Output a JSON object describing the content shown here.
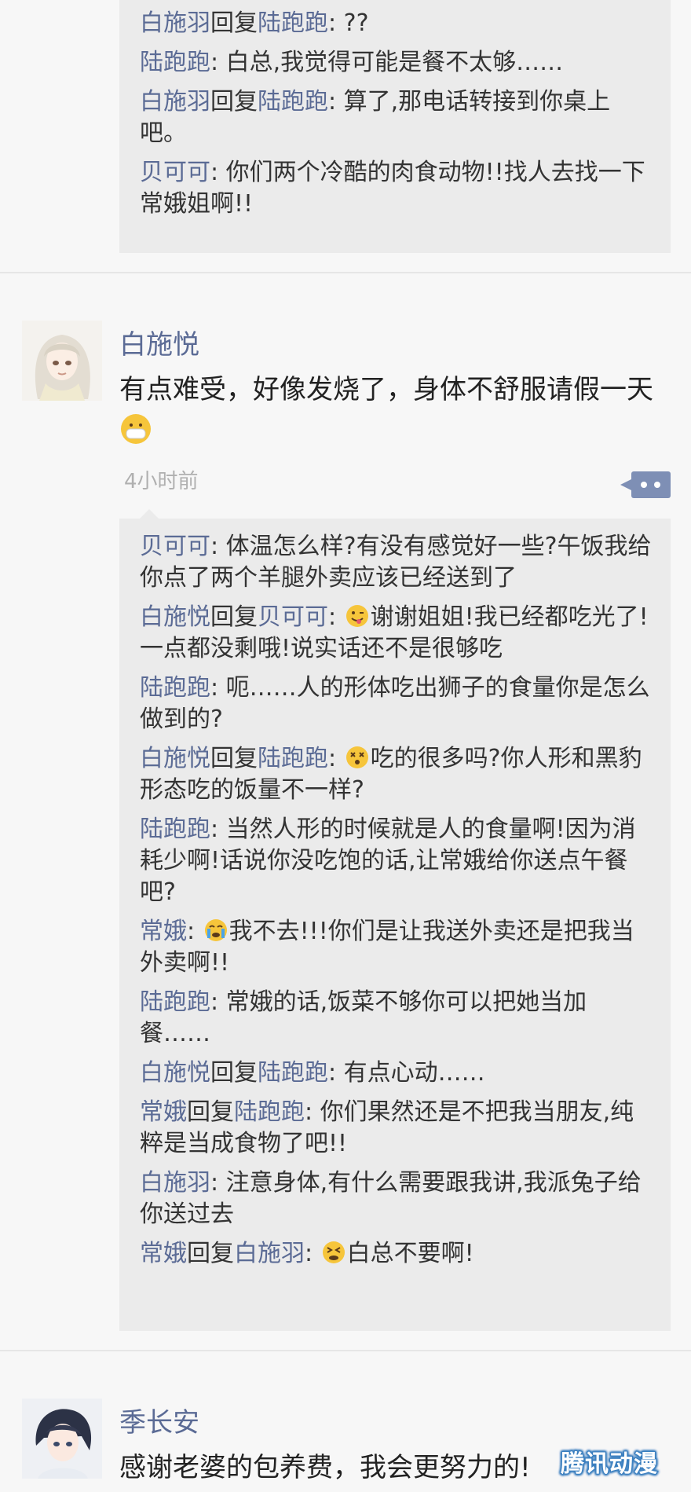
{
  "top_replies": [
    {
      "parts": [
        {
          "n": "白施羽"
        },
        {
          "t": "回复"
        },
        {
          "n": "陆跑跑"
        },
        {
          "t": ": ??"
        }
      ]
    },
    {
      "parts": [
        {
          "n": "陆跑跑"
        },
        {
          "t": ": 白总,我觉得可能是餐不太够……"
        }
      ]
    },
    {
      "parts": [
        {
          "n": "白施羽"
        },
        {
          "t": "回复"
        },
        {
          "n": "陆跑跑"
        },
        {
          "t": ": 算了,那电话转接到你桌上吧。"
        }
      ]
    },
    {
      "parts": [
        {
          "n": "贝可可"
        },
        {
          "t": ": 你们两个冷酷的肉食动物!!找人去找一下常娥姐啊!!"
        }
      ]
    }
  ],
  "post2": {
    "author": "白施悦",
    "content": "有点难受，好像发烧了，身体不舒服请假一天",
    "content_emoji": "mask-face-emoji",
    "time": "4小时前",
    "replies": [
      {
        "parts": [
          {
            "n": "贝可可"
          },
          {
            "t": ": 体温怎么样?有没有感觉好一些?午饭我给你点了两个羊腿外卖应该已经送到了"
          }
        ]
      },
      {
        "parts": [
          {
            "n": "白施悦"
          },
          {
            "t": "回复"
          },
          {
            "n": "贝可可"
          },
          {
            "t": ": "
          },
          {
            "e": "tongue-wink-emoji"
          },
          {
            "t": "谢谢姐姐!我已经都吃光了!一点都没剩哦!说实话还不是很够吃"
          }
        ]
      },
      {
        "parts": [
          {
            "n": "陆跑跑"
          },
          {
            "t": ": 呃……人的形体吃出狮子的食量你是怎么做到的?"
          }
        ]
      },
      {
        "parts": [
          {
            "n": "白施悦"
          },
          {
            "t": "回复"
          },
          {
            "n": "陆跑跑"
          },
          {
            "t": ": "
          },
          {
            "e": "dizzy-face-emoji"
          },
          {
            "t": "吃的很多吗?你人形和黑豹形态吃的饭量不一样?"
          }
        ]
      },
      {
        "parts": [
          {
            "n": "陆跑跑"
          },
          {
            "t": ": 当然人形的时候就是人的食量啊!因为消耗少啊!话说你没吃饱的话,让常娥给你送点午餐吧?"
          }
        ]
      },
      {
        "parts": [
          {
            "n": "常娥"
          },
          {
            "t": ": "
          },
          {
            "e": "crying-face-emoji"
          },
          {
            "t": "我不去!!!你们是让我送外卖还是把我当外卖啊!!"
          }
        ]
      },
      {
        "parts": [
          {
            "n": "陆跑跑"
          },
          {
            "t": ": 常娥的话,饭菜不够你可以把她当加餐……"
          }
        ]
      },
      {
        "parts": [
          {
            "n": "白施悦"
          },
          {
            "t": "回复"
          },
          {
            "n": "陆跑跑"
          },
          {
            "t": ": 有点心动……"
          }
        ]
      },
      {
        "parts": [
          {
            "n": "常娥"
          },
          {
            "t": "回复"
          },
          {
            "n": "陆跑跑"
          },
          {
            "t": ": 你们果然还是不把我当朋友,纯粹是当成食物了吧!!"
          }
        ]
      },
      {
        "parts": [
          {
            "n": "白施羽"
          },
          {
            "t": ": 注意身体,有什么需要跟我讲,我派兔子给你送过去"
          }
        ]
      },
      {
        "parts": [
          {
            "n": "常娥"
          },
          {
            "t": "回复"
          },
          {
            "n": "白施羽"
          },
          {
            "t": ": "
          },
          {
            "e": "tired-face-emoji"
          },
          {
            "t": "白总不要啊!"
          }
        ]
      }
    ]
  },
  "post3": {
    "author": "季长安",
    "content": "感谢老婆的包养费，我会更努力的!"
  },
  "watermark": "腾讯动漫"
}
